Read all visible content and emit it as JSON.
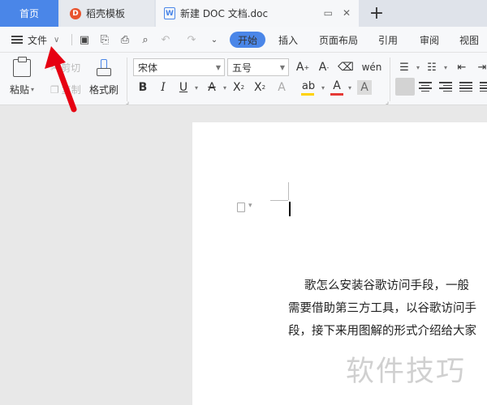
{
  "tabs": {
    "home": "首页",
    "template": "稻壳模板",
    "doc": "新建 DOC 文档.doc",
    "add": "+"
  },
  "menu": {
    "file": "文件",
    "items": [
      "开始",
      "插入",
      "页面布局",
      "引用",
      "审阅",
      "视图"
    ],
    "active": "开始"
  },
  "ribbon": {
    "paste": "粘贴",
    "cut": "剪切",
    "copy": "复制",
    "format_painter": "格式刷",
    "font_name": "宋体",
    "font_size": "五号"
  },
  "document": {
    "lines": [
      "歌怎么安装谷歌访问手段，一般",
      "需要借助第三方工具，以谷歌访问手",
      "段，接下来用图解的形式介绍给大家"
    ]
  },
  "watermark": "软件技巧",
  "colors": {
    "accent": "#4a86e8",
    "annotation_arrow": "#e60012",
    "highlight_yellow": "#ffd200",
    "font_color_red": "#e53935"
  }
}
